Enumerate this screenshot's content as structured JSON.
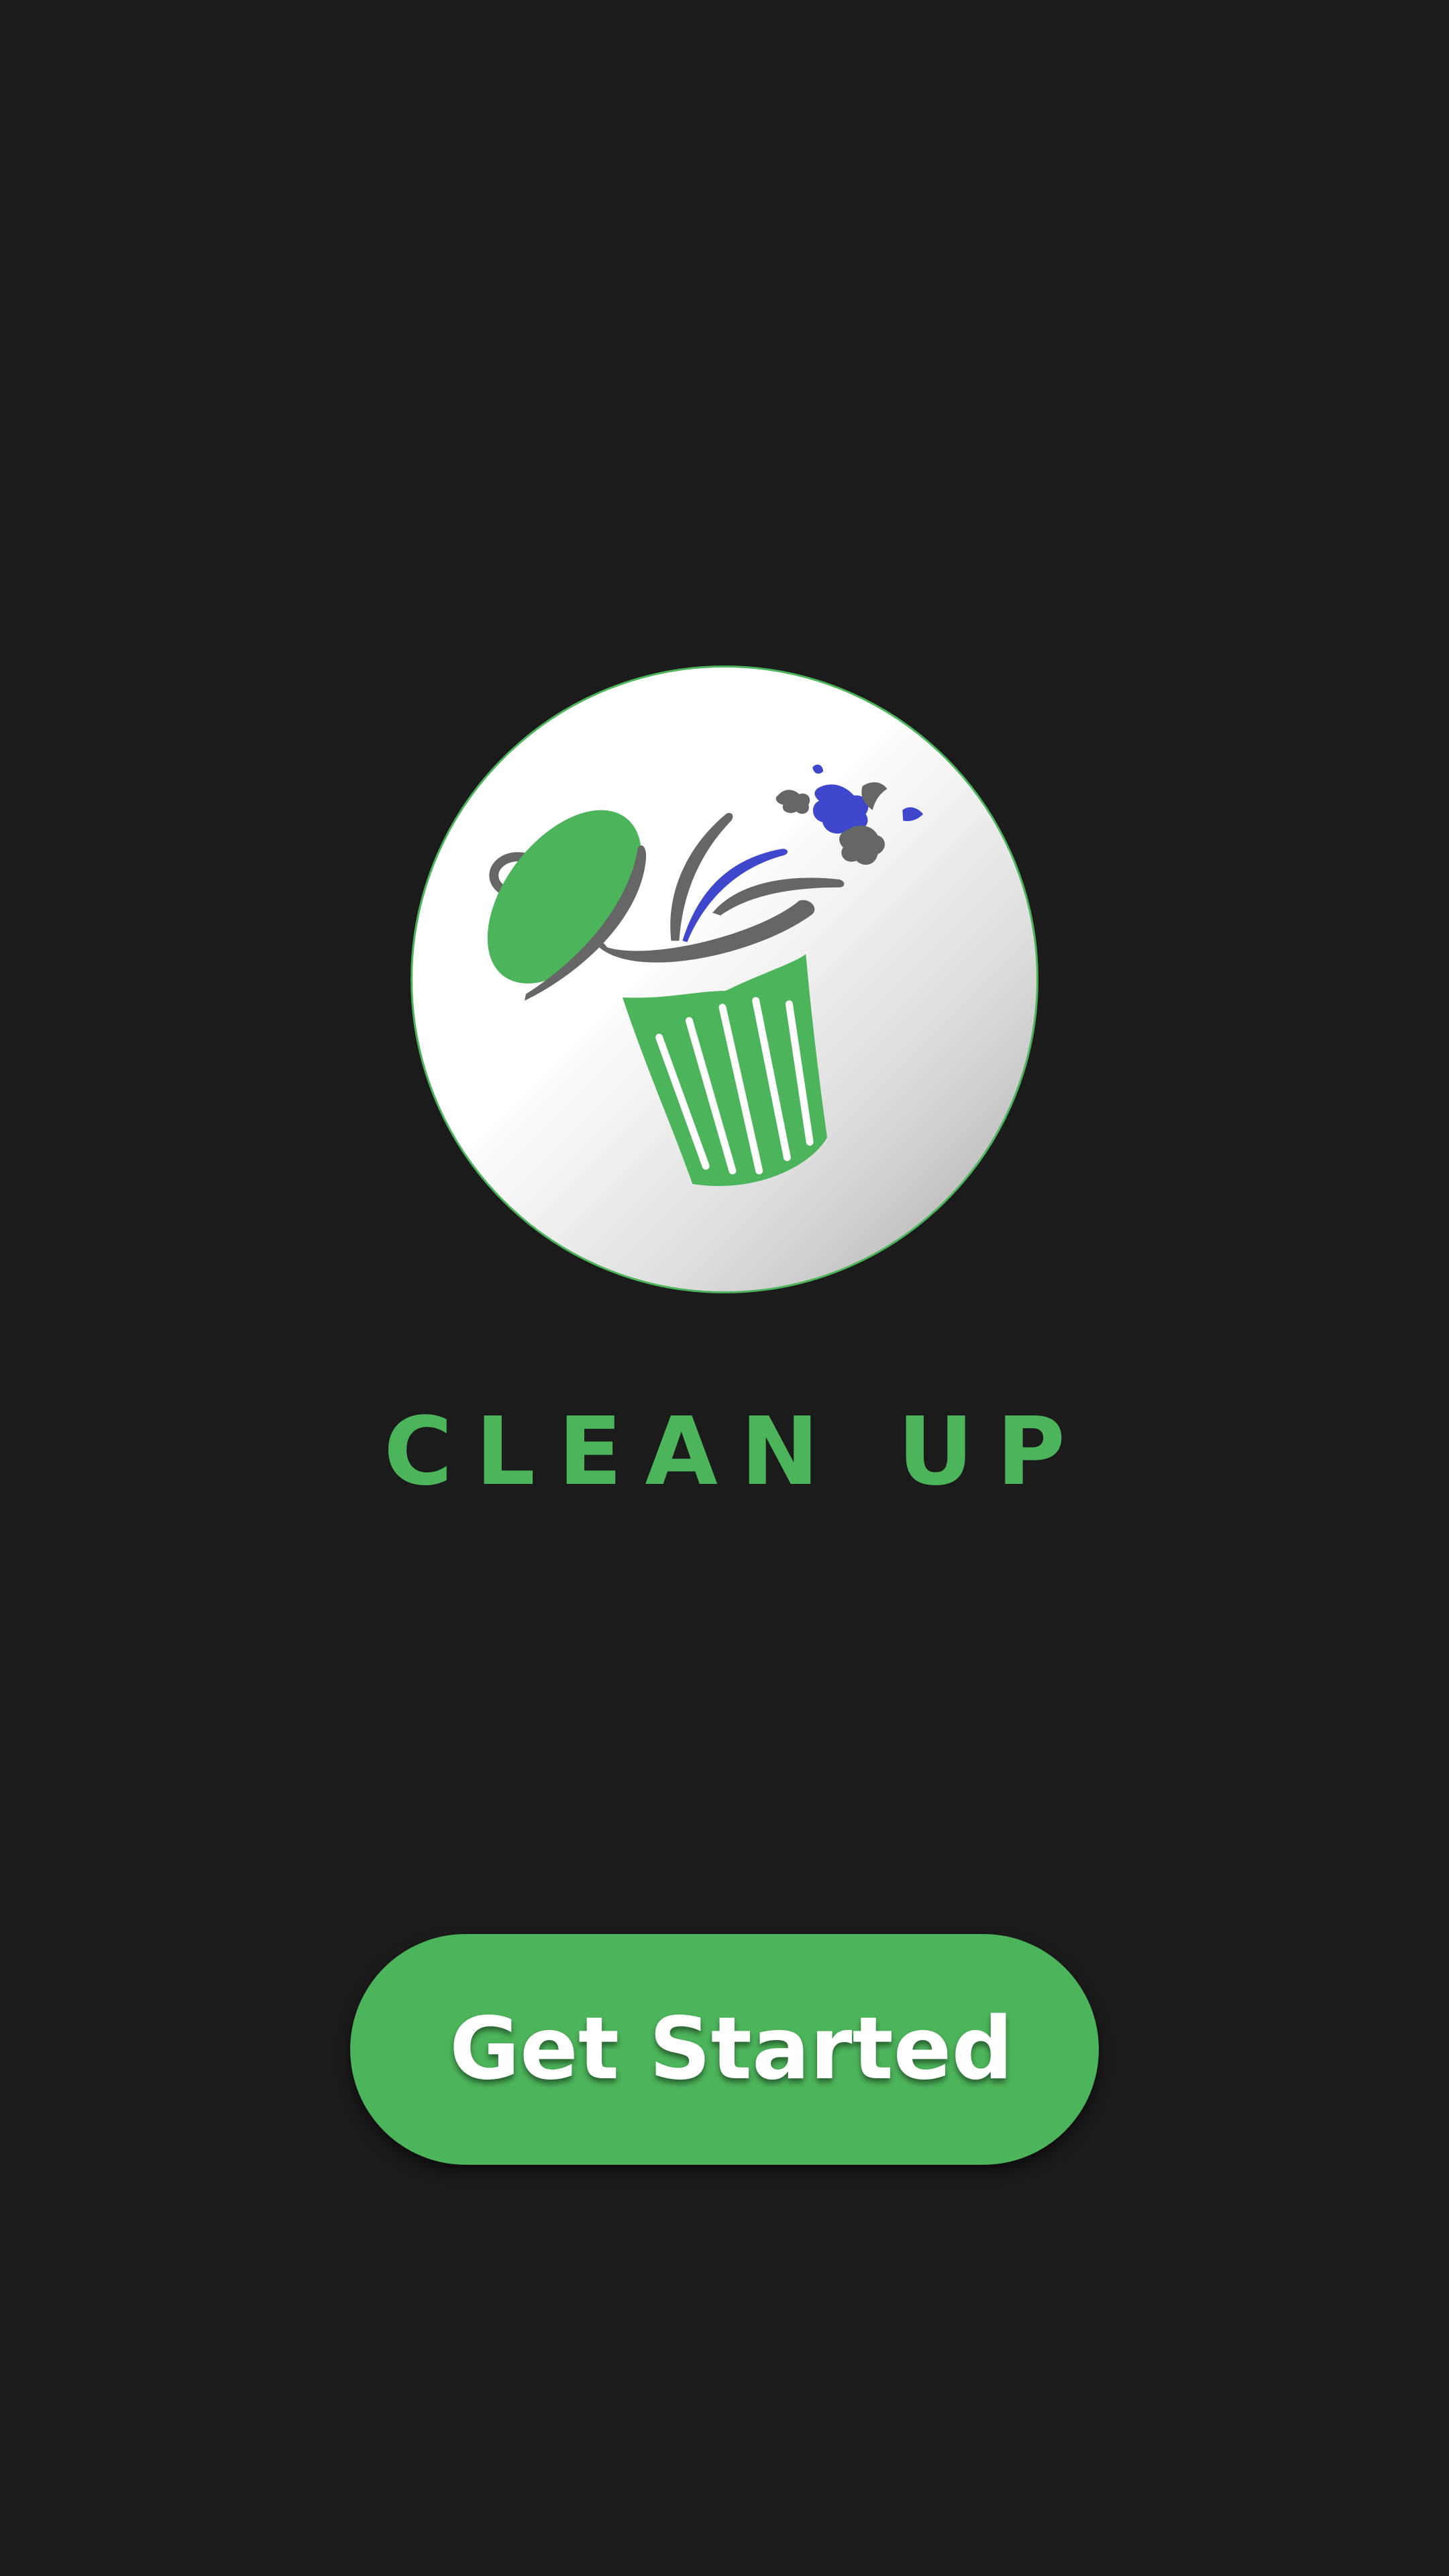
{
  "app": {
    "title": "CLEAN UP",
    "brand_color": "#4cb45a"
  },
  "logo": {
    "icon": "trash-can-icon",
    "colors": {
      "bin": "#4cb45a",
      "lid_handle": "#666666",
      "sparkle_blue": "#3f48cc",
      "sparkle_gray": "#666666"
    }
  },
  "actions": {
    "get_started_label": "Get Started"
  },
  "theme": {
    "background": "#1b1b1b",
    "text_on_button": "#ffffff"
  }
}
